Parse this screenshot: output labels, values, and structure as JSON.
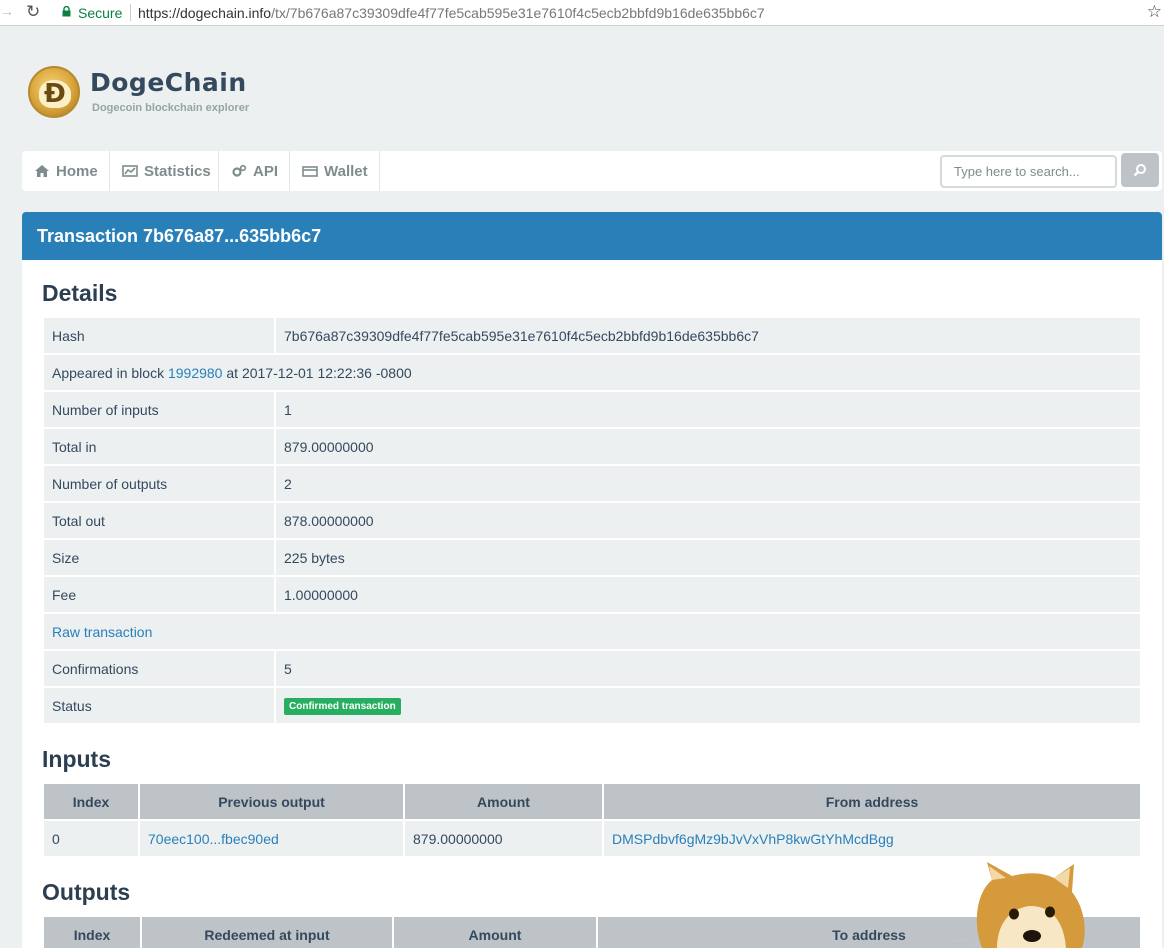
{
  "browser": {
    "secure_label": "Secure",
    "url_host": "https://dogechain.info",
    "url_path": "/tx/7b676a87c39309dfe4f77fe5cab595e31e7610f4c5ecb2bbfd9b16de635bb6c7"
  },
  "header": {
    "brand": "DogeChain",
    "tagline": "Dogecoin blockchain explorer"
  },
  "nav": {
    "home": "Home",
    "statistics": "Statistics",
    "api": "API",
    "wallet": "Wallet",
    "search_placeholder": "Type here to search..."
  },
  "panel": {
    "title": "Transaction 7b676a87...635bb6c7"
  },
  "details": {
    "heading": "Details",
    "hash_label": "Hash",
    "hash_value": "7b676a87c39309dfe4f77fe5cab595e31e7610f4c5ecb2bbfd9b16de635bb6c7",
    "appeared_prefix": "Appeared in block",
    "block_number": "1992980",
    "appeared_suffix": "at 2017-12-01 12:22:36 -0800",
    "num_inputs_label": "Number of inputs",
    "num_inputs_value": "1",
    "total_in_label": "Total in",
    "total_in_value": "879.00000000",
    "num_outputs_label": "Number of outputs",
    "num_outputs_value": "2",
    "total_out_label": "Total out",
    "total_out_value": "878.00000000",
    "size_label": "Size",
    "size_value": "225 bytes",
    "fee_label": "Fee",
    "fee_value": "1.00000000",
    "raw_link": "Raw transaction",
    "confirmations_label": "Confirmations",
    "confirmations_value": "5",
    "status_label": "Status",
    "status_value": "Confirmed transaction"
  },
  "inputs": {
    "heading": "Inputs",
    "columns": [
      "Index",
      "Previous output",
      "Amount",
      "From address"
    ],
    "rows": [
      {
        "index": "0",
        "previous_output": "70eec100...fbec90ed",
        "amount": "879.00000000",
        "from_address": "DMSPdbvf6gMz9bJvVxVhP8kwGtYhMcdBgg"
      }
    ]
  },
  "outputs": {
    "heading": "Outputs",
    "columns": [
      "Index",
      "Redeemed at input",
      "Amount",
      "To address"
    ]
  },
  "colors": {
    "page_bg": "#ecf0f1",
    "panel_header": "#2980b9",
    "link": "#2980b9",
    "badge": "#27ae60",
    "table_header": "#bdc3c7"
  }
}
